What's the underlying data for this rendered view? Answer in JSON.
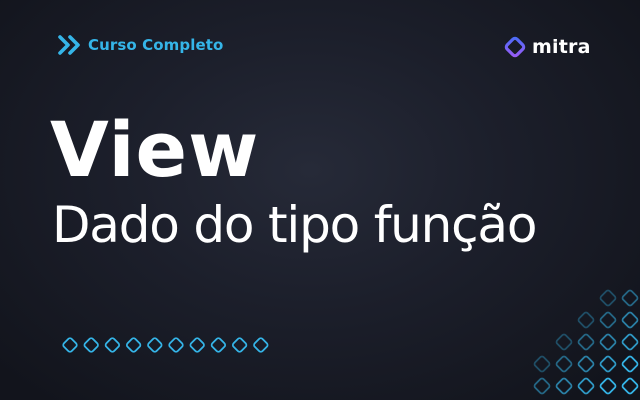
{
  "course_tag": {
    "label": "Curso Completo",
    "icon": "double-chevron-right-icon"
  },
  "brand": {
    "name": "mitra",
    "icon": "mitra-diamond-logo-icon"
  },
  "title": "View",
  "subtitle": "Dado do tipo função",
  "decorations": {
    "dots_count": 10,
    "pattern": "diamond-grid"
  },
  "colors": {
    "background": "#1c1f2b",
    "accent_cyan": "#35b5e8",
    "brand_gradient": [
      "#4a6cf7",
      "#9b5cf6"
    ],
    "text": "#ffffff"
  }
}
